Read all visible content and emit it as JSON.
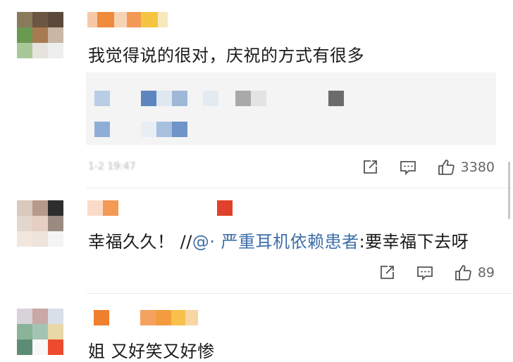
{
  "comments": [
    {
      "text": "我觉得说的很对，庆祝的方式有很多",
      "timestamp": "1-2 19:47",
      "like_count": "3380",
      "has_quote": true
    },
    {
      "text_prefix": "幸福久久！ //",
      "mention": "@· 严重耳机依赖患者",
      "text_suffix": ":要幸福下去呀",
      "like_count": "89"
    },
    {
      "text": "姐 又好笑又好惨"
    }
  ],
  "icons": [
    "repost-icon",
    "comment-icon",
    "like-icon"
  ],
  "colors": {
    "mention": "#3f6fa8",
    "icon": "#555555",
    "like_count": "#666666",
    "divider": "#ececec"
  }
}
